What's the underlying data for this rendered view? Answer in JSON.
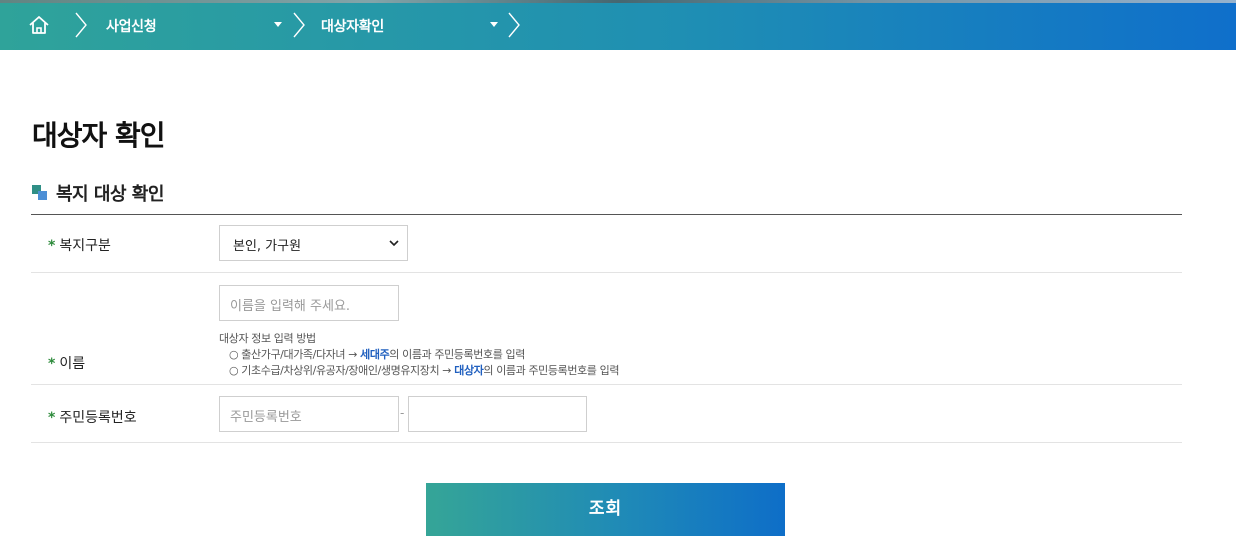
{
  "breadcrumb": {
    "home_icon": "home-icon",
    "items": [
      {
        "label": "사업신청",
        "has_dropdown": true
      },
      {
        "label": "대상자확인",
        "has_dropdown": true
      }
    ]
  },
  "page": {
    "title": "대상자 확인"
  },
  "section": {
    "title": "복지 대상 확인"
  },
  "form": {
    "welfare_type": {
      "label": "복지구분",
      "required_mark": "*",
      "selected": "본인, 가구원"
    },
    "name": {
      "label": "이름",
      "required_mark": "*",
      "placeholder": "이름을 입력해 주세요.",
      "value": ""
    },
    "help": {
      "title": "대상자 정보 입력 방법",
      "lines": [
        {
          "prefix": "○ 출산가구/대가족/다자녀 → ",
          "highlight": "세대주",
          "suffix": "의 이름과 주민등록번호를 입력"
        },
        {
          "prefix": "○ 기초수급/차상위/유공자/장애인/생명유지장치 → ",
          "highlight": "대상자",
          "suffix": "의 이름과 주민등록번호를 입력"
        }
      ]
    },
    "rrn": {
      "label": "주민등록번호",
      "required_mark": "*",
      "front_placeholder": "주민등록번호",
      "separator": "-",
      "back_value": ""
    }
  },
  "submit": {
    "label": "조회"
  },
  "colors": {
    "bar_start": "#2fa39a",
    "bar_end": "#0f6fcb",
    "required_star": "#2e8b3c",
    "highlight": "#1f5fbf"
  }
}
